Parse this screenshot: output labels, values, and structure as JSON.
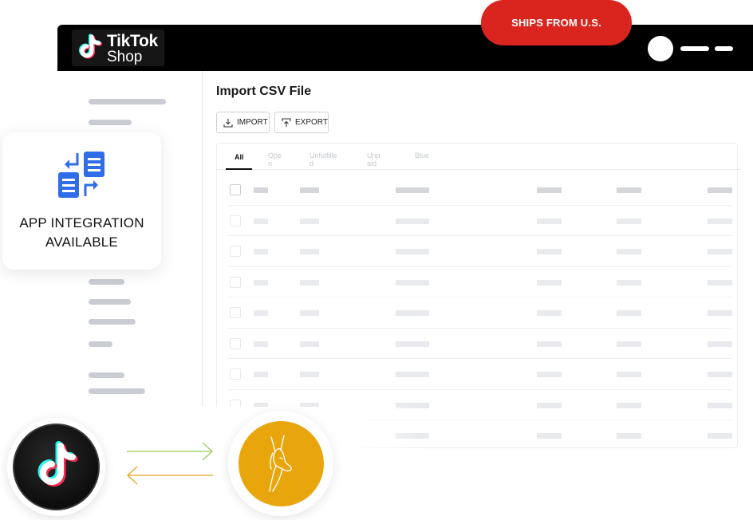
{
  "brand": {
    "line1": "TikTok",
    "line2": "Shop",
    "icon": "tiktok-logo-icon"
  },
  "ships_badge": "SHIPS FROM U.S.",
  "integration_card": {
    "icon": "file-transfer-icon",
    "line1": "APP INTEGRATION",
    "line2": "AVAILABLE"
  },
  "main": {
    "title": "Import CSV File",
    "buttons": [
      {
        "label": "IMPORT",
        "icon": "download-tray-icon"
      },
      {
        "label": "EXPORT",
        "icon": "upload-tray-icon"
      }
    ],
    "tabs": [
      "All",
      "Open",
      "Unfulfilled",
      "Unpaid",
      "Blue"
    ]
  },
  "colors": {
    "accent_red": "#d9251d",
    "icon_blue": "#2f6ee8",
    "brand_gold": "#e9a50c",
    "arrow_green": "#9acb58",
    "arrow_gold": "#e2a71c"
  },
  "bottom": {
    "left_icon": "tiktok-logo-icon",
    "right_icon": "dog-logo-icon",
    "connector": "two-way-arrows-icon"
  }
}
